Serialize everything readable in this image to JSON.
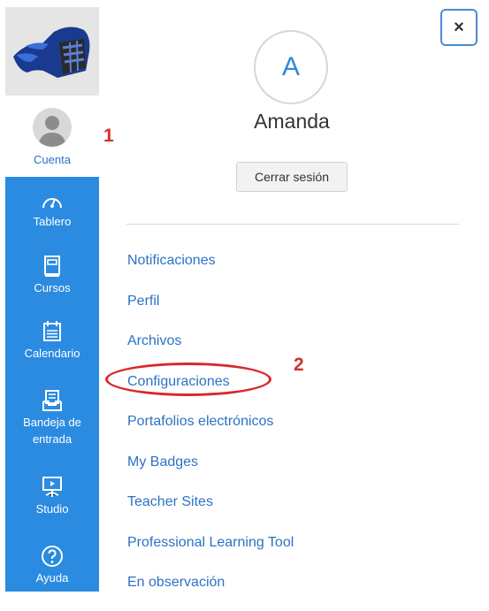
{
  "nav": {
    "account_label": "Cuenta",
    "items": [
      {
        "label": "Tablero",
        "icon": "dashboard-icon"
      },
      {
        "label": "Cursos",
        "icon": "courses-icon"
      },
      {
        "label": "Calendario",
        "icon": "calendar-icon"
      },
      {
        "label": "Bandeja de entrada",
        "icon": "inbox-icon"
      },
      {
        "label": "Studio",
        "icon": "studio-icon"
      },
      {
        "label": "Ayuda",
        "icon": "help-icon"
      }
    ]
  },
  "tray": {
    "avatar_initial": "A",
    "user_name": "Amanda",
    "logout_label": "Cerrar sesión",
    "close_label": "×",
    "links": [
      "Notificaciones",
      "Perfil",
      "Archivos",
      "Configuraciones",
      "Portafolios electrónicos",
      "My Badges",
      "Teacher Sites",
      "Professional Learning Tool",
      "En observación"
    ]
  },
  "annotations": {
    "step1": "1",
    "step2": "2"
  },
  "colors": {
    "nav_blue": "#2b8be0",
    "link_blue": "#2d72c4",
    "annotation_red": "#d0312d"
  }
}
